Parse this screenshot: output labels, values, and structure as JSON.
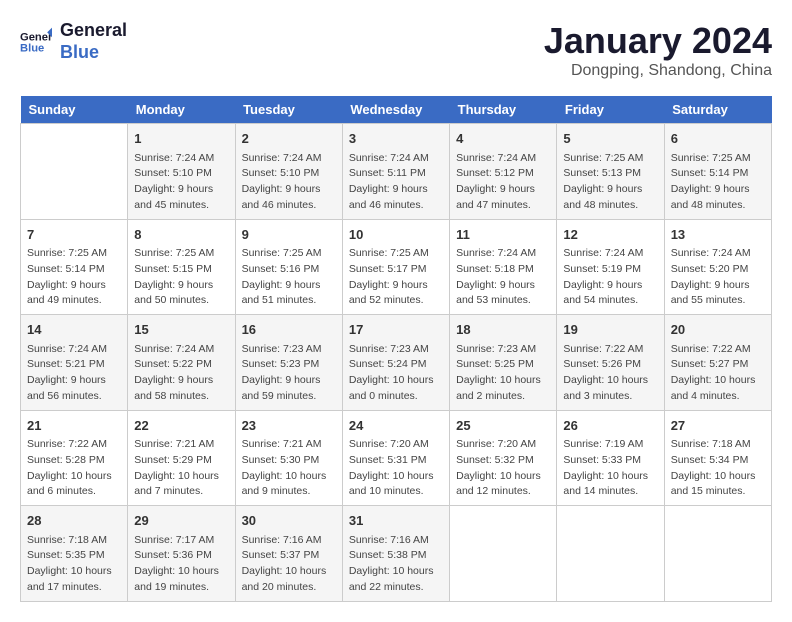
{
  "logo": {
    "line1": "General",
    "line2": "Blue"
  },
  "title": "January 2024",
  "subtitle": "Dongping, Shandong, China",
  "days_header": [
    "Sunday",
    "Monday",
    "Tuesday",
    "Wednesday",
    "Thursday",
    "Friday",
    "Saturday"
  ],
  "weeks": [
    [
      {
        "day": "",
        "info": ""
      },
      {
        "day": "1",
        "info": "Sunrise: 7:24 AM\nSunset: 5:10 PM\nDaylight: 9 hours\nand 45 minutes."
      },
      {
        "day": "2",
        "info": "Sunrise: 7:24 AM\nSunset: 5:10 PM\nDaylight: 9 hours\nand 46 minutes."
      },
      {
        "day": "3",
        "info": "Sunrise: 7:24 AM\nSunset: 5:11 PM\nDaylight: 9 hours\nand 46 minutes."
      },
      {
        "day": "4",
        "info": "Sunrise: 7:24 AM\nSunset: 5:12 PM\nDaylight: 9 hours\nand 47 minutes."
      },
      {
        "day": "5",
        "info": "Sunrise: 7:25 AM\nSunset: 5:13 PM\nDaylight: 9 hours\nand 48 minutes."
      },
      {
        "day": "6",
        "info": "Sunrise: 7:25 AM\nSunset: 5:14 PM\nDaylight: 9 hours\nand 48 minutes."
      }
    ],
    [
      {
        "day": "7",
        "info": "Sunrise: 7:25 AM\nSunset: 5:14 PM\nDaylight: 9 hours\nand 49 minutes."
      },
      {
        "day": "8",
        "info": "Sunrise: 7:25 AM\nSunset: 5:15 PM\nDaylight: 9 hours\nand 50 minutes."
      },
      {
        "day": "9",
        "info": "Sunrise: 7:25 AM\nSunset: 5:16 PM\nDaylight: 9 hours\nand 51 minutes."
      },
      {
        "day": "10",
        "info": "Sunrise: 7:25 AM\nSunset: 5:17 PM\nDaylight: 9 hours\nand 52 minutes."
      },
      {
        "day": "11",
        "info": "Sunrise: 7:24 AM\nSunset: 5:18 PM\nDaylight: 9 hours\nand 53 minutes."
      },
      {
        "day": "12",
        "info": "Sunrise: 7:24 AM\nSunset: 5:19 PM\nDaylight: 9 hours\nand 54 minutes."
      },
      {
        "day": "13",
        "info": "Sunrise: 7:24 AM\nSunset: 5:20 PM\nDaylight: 9 hours\nand 55 minutes."
      }
    ],
    [
      {
        "day": "14",
        "info": "Sunrise: 7:24 AM\nSunset: 5:21 PM\nDaylight: 9 hours\nand 56 minutes."
      },
      {
        "day": "15",
        "info": "Sunrise: 7:24 AM\nSunset: 5:22 PM\nDaylight: 9 hours\nand 58 minutes."
      },
      {
        "day": "16",
        "info": "Sunrise: 7:23 AM\nSunset: 5:23 PM\nDaylight: 9 hours\nand 59 minutes."
      },
      {
        "day": "17",
        "info": "Sunrise: 7:23 AM\nSunset: 5:24 PM\nDaylight: 10 hours\nand 0 minutes."
      },
      {
        "day": "18",
        "info": "Sunrise: 7:23 AM\nSunset: 5:25 PM\nDaylight: 10 hours\nand 2 minutes."
      },
      {
        "day": "19",
        "info": "Sunrise: 7:22 AM\nSunset: 5:26 PM\nDaylight: 10 hours\nand 3 minutes."
      },
      {
        "day": "20",
        "info": "Sunrise: 7:22 AM\nSunset: 5:27 PM\nDaylight: 10 hours\nand 4 minutes."
      }
    ],
    [
      {
        "day": "21",
        "info": "Sunrise: 7:22 AM\nSunset: 5:28 PM\nDaylight: 10 hours\nand 6 minutes."
      },
      {
        "day": "22",
        "info": "Sunrise: 7:21 AM\nSunset: 5:29 PM\nDaylight: 10 hours\nand 7 minutes."
      },
      {
        "day": "23",
        "info": "Sunrise: 7:21 AM\nSunset: 5:30 PM\nDaylight: 10 hours\nand 9 minutes."
      },
      {
        "day": "24",
        "info": "Sunrise: 7:20 AM\nSunset: 5:31 PM\nDaylight: 10 hours\nand 10 minutes."
      },
      {
        "day": "25",
        "info": "Sunrise: 7:20 AM\nSunset: 5:32 PM\nDaylight: 10 hours\nand 12 minutes."
      },
      {
        "day": "26",
        "info": "Sunrise: 7:19 AM\nSunset: 5:33 PM\nDaylight: 10 hours\nand 14 minutes."
      },
      {
        "day": "27",
        "info": "Sunrise: 7:18 AM\nSunset: 5:34 PM\nDaylight: 10 hours\nand 15 minutes."
      }
    ],
    [
      {
        "day": "28",
        "info": "Sunrise: 7:18 AM\nSunset: 5:35 PM\nDaylight: 10 hours\nand 17 minutes."
      },
      {
        "day": "29",
        "info": "Sunrise: 7:17 AM\nSunset: 5:36 PM\nDaylight: 10 hours\nand 19 minutes."
      },
      {
        "day": "30",
        "info": "Sunrise: 7:16 AM\nSunset: 5:37 PM\nDaylight: 10 hours\nand 20 minutes."
      },
      {
        "day": "31",
        "info": "Sunrise: 7:16 AM\nSunset: 5:38 PM\nDaylight: 10 hours\nand 22 minutes."
      },
      {
        "day": "",
        "info": ""
      },
      {
        "day": "",
        "info": ""
      },
      {
        "day": "",
        "info": ""
      }
    ]
  ]
}
